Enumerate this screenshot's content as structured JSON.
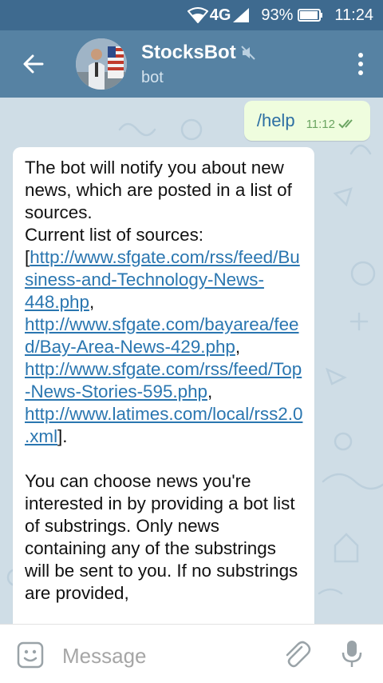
{
  "status_bar": {
    "network": "4G",
    "battery": "93%",
    "time": "11:24"
  },
  "header": {
    "title": "StocksBot",
    "subtitle": "bot"
  },
  "outgoing": {
    "text": "/help",
    "time": "11:12"
  },
  "incoming": {
    "line1": "The bot will notify you about new news, which are posted in a list of sources.",
    "line2": "Current list of sources:",
    "open_bracket": "[",
    "link1": "http://www.sfgate.com/rss/feed/Business-and-Technology-News-448.php",
    "sep1": ", ",
    "link2": "http://www.sfgate.com/bayarea/feed/Bay-Area-News-429.php",
    "sep2": ", ",
    "link3": "http://www.sfgate.com/rss/feed/Top-News-Stories-595.php",
    "sep3": ", ",
    "link4": "http://www.latimes.com/local/rss2.0.xml",
    "close_bracket": "].",
    "para2": "You can choose news you're interested in by providing a bot list of substrings. Only news containing any of the substrings will be sent to you. If no substrings are provided,"
  },
  "composer": {
    "placeholder": "Message"
  },
  "colors": {
    "status_bar": "#3e6a8f",
    "app_bar": "#5682a3",
    "chat_bg": "#cfdde6",
    "outgoing_bubble": "#effdde",
    "link": "#2a76b0"
  },
  "icons": [
    "wifi-icon",
    "signal-icon",
    "battery-icon",
    "back-arrow-icon",
    "mute-icon",
    "more-vert-icon",
    "double-check-icon",
    "emoji-icon",
    "attach-icon",
    "mic-icon"
  ]
}
